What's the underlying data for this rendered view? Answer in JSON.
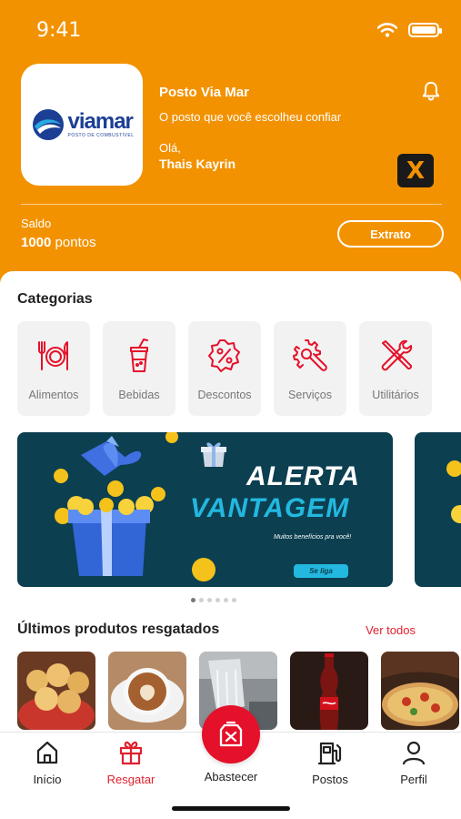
{
  "status_bar": {
    "time": "9:41"
  },
  "header": {
    "logo": {
      "brand": "viamar",
      "subtitle": "POSTO DE COMBUSTÍVEL"
    },
    "station_name": "Posto Via Mar",
    "station_tagline": "O posto que você escolheu confiar",
    "greeting": "Olá,",
    "user_name": "Thais Kayrin",
    "partner_badge": "X",
    "balance": {
      "label": "Saldo",
      "value": "1000",
      "unit": "pontos"
    },
    "statement_button": "Extrato"
  },
  "categories": {
    "title": "Categorias",
    "items": [
      {
        "label": "Alimentos",
        "icon": "utensils-icon"
      },
      {
        "label": "Bebidas",
        "icon": "drink-cup-icon"
      },
      {
        "label": "Descontos",
        "icon": "discount-badge-icon"
      },
      {
        "label": "Serviços",
        "icon": "wrench-gear-icon"
      },
      {
        "label": "Utilitários",
        "icon": "tools-icon"
      }
    ]
  },
  "banner": {
    "line1": "ALERTA",
    "line2": "VANTAGEM",
    "subtitle": "Muitos benefícios pra você!",
    "cta": "Se liga",
    "slides_total": 6,
    "active_slide": 1
  },
  "recent_products": {
    "title": "Últimos produtos resgatados",
    "see_all": "Ver todos",
    "items": [
      "pao-de-queijo",
      "cappuccino",
      "car-wash",
      "coca-cola",
      "pizza"
    ]
  },
  "tabbar": {
    "items": [
      {
        "label": "Início",
        "icon": "home-icon",
        "active": false
      },
      {
        "label": "Resgatar",
        "icon": "gift-icon",
        "active": true
      },
      {
        "label": "Abastecer",
        "icon": "fuel-can-icon",
        "active": false
      },
      {
        "label": "Postos",
        "icon": "gas-station-icon",
        "active": false
      },
      {
        "label": "Perfil",
        "icon": "user-icon",
        "active": false
      }
    ]
  },
  "colors": {
    "primary": "#f39200",
    "accent": "#e0202d",
    "banner_bg": "#0c3f50",
    "banner_highlight": "#22b8e0"
  }
}
